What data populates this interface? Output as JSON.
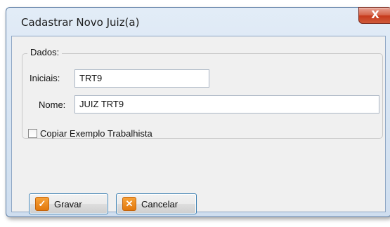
{
  "window": {
    "title": "Cadastrar Novo Juiz(a)",
    "close_icon": "close-icon",
    "close_glyph": "X"
  },
  "form": {
    "group_title": "Dados:",
    "iniciais_label": "Iniciais:",
    "iniciais_value": "TRT9",
    "nome_label": "Nome:",
    "nome_value": "JUIZ TRT9",
    "copiar_label": "Copiar Exemplo Trabalhista",
    "copiar_checked": false
  },
  "buttons": {
    "gravar_label": "Gravar",
    "gravar_icon": "checkmark-icon",
    "cancelar_label": "Cancelar",
    "cancelar_icon": "x-icon"
  },
  "colors": {
    "title_bar": "#d5e3f2",
    "close_button": "#c63a1c",
    "button_icon": "#e2780c",
    "button_border": "#3c7fb1"
  }
}
